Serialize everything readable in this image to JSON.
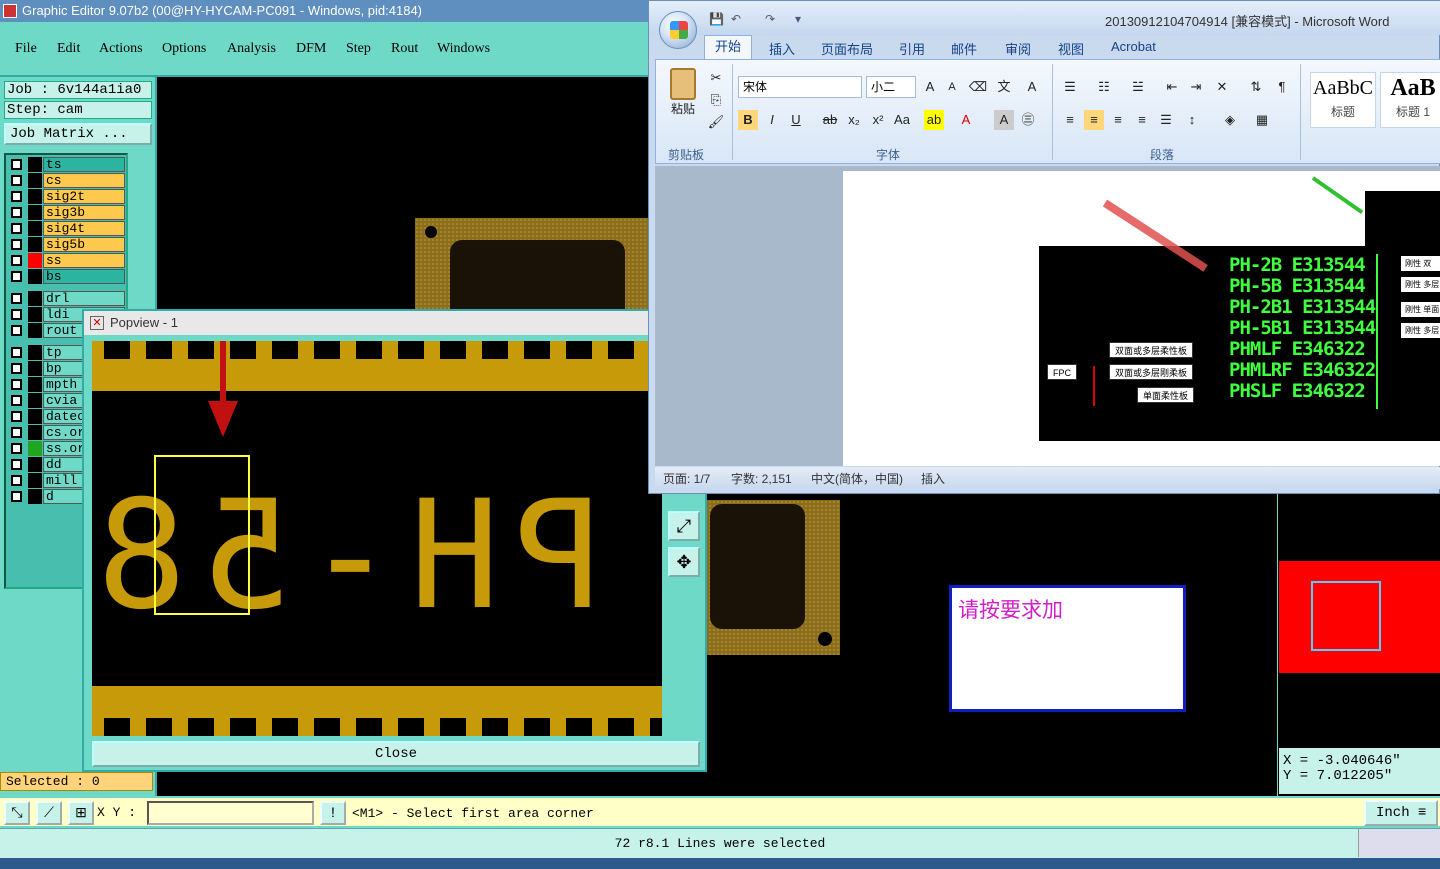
{
  "cam": {
    "title": "Graphic Editor 9.07b2 (00@HY-HYCAM-PC091 - Windows, pid:4184)",
    "menu": [
      "File",
      "Edit",
      "Actions",
      "Options",
      "Analysis",
      "DFM",
      "Step",
      "Rout",
      "Windows"
    ],
    "job": "Job : 6v144a1ia0",
    "step": "Step: cam",
    "job_matrix_button": "Job Matrix ...",
    "layers": [
      {
        "name": "ts",
        "color": "#2bb5a0"
      },
      {
        "name": "cs",
        "color": "#ffc94d"
      },
      {
        "name": "sig2t",
        "color": "#ffc94d"
      },
      {
        "name": "sig3b",
        "color": "#ffc94d"
      },
      {
        "name": "sig4t",
        "color": "#ffc94d"
      },
      {
        "name": "sig5b",
        "color": "#ffc94d"
      },
      {
        "name": "ss",
        "color": "#ffc94d",
        "marker": "#ff0000",
        "active": true
      },
      {
        "name": "bs",
        "color": "#2bb5a0"
      },
      {
        "name": "drl",
        "color": "#6fd9c7"
      },
      {
        "name": "ldi",
        "color": "#6fd9c7"
      },
      {
        "name": "rout",
        "color": "#6fd9c7"
      },
      {
        "name": "tp",
        "color": "#6fd9c7"
      },
      {
        "name": "bp",
        "color": "#6fd9c7"
      },
      {
        "name": "mpth",
        "color": "#6fd9c7"
      },
      {
        "name": "cvia",
        "color": "#6fd9c7"
      },
      {
        "name": "datecode",
        "color": "#6fd9c7"
      },
      {
        "name": "cs.orig",
        "color": "#6fd9c7"
      },
      {
        "name": "ss.orig",
        "color": "#6fd9c7",
        "marker": "#1fa51f"
      },
      {
        "name": "dd",
        "color": "#6fd9c7"
      },
      {
        "name": "mill",
        "color": "#6fd9c7"
      },
      {
        "name": "d",
        "color": "#6fd9c7"
      }
    ],
    "selected": "Selected : 0",
    "popview": {
      "title": "Popview - 1",
      "text": "PH-58",
      "close_button": "Close"
    },
    "instruction": "请按要求加",
    "coords": {
      "x": "X = -3.040646\"",
      "y": "Y = 7.012205\""
    },
    "xy_label": "X Y :",
    "xy_value": "",
    "prompt": "<M1> - Select first area corner",
    "unit": "Inch",
    "status": "72 r8.1 Lines were selected"
  },
  "word": {
    "title": "20130912104704914 [兼容模式] - Microsoft Word",
    "tabs": [
      "开始",
      "插入",
      "页面布局",
      "引用",
      "邮件",
      "审阅",
      "视图",
      "Acrobat"
    ],
    "paste_label": "粘贴",
    "font_name": "宋体",
    "font_size": "小二",
    "group_labels": {
      "clipboard": "剪贴板",
      "font": "字体",
      "paragraph": "段落"
    },
    "styles": [
      {
        "sample": "AaBbC",
        "label": "标题"
      },
      {
        "sample": "AaB",
        "label": "标题 1"
      }
    ],
    "doc_codes": [
      "PH-2B E313544",
      "PH-5B E313544",
      "PH-2B1 E313544",
      "PH-5B1 E313544",
      "PHMLF E346322",
      "PHMLRF E346322",
      "PHSLF E346322"
    ],
    "right_labels": [
      "刚性 双",
      "刚性 多层",
      "刚性 单面",
      "刚性 多层"
    ],
    "left_labels": [
      "双面或多层柔性板",
      "双面或多层刚柔板",
      "单面柔性板"
    ],
    "fpc_label": "FPC",
    "status": {
      "page": "页面: 1/7",
      "words": "字数: 2,151",
      "lang": "中文(简体，中国)",
      "mode": "插入"
    }
  }
}
